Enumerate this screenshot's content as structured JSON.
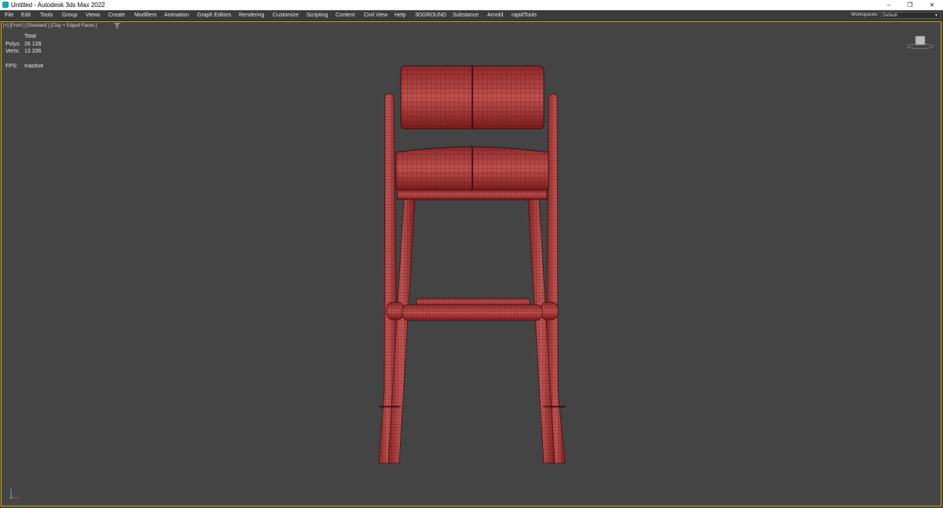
{
  "window": {
    "title": "Untitled - Autodesk 3ds Max 2022",
    "controls": {
      "minimize": "–",
      "restore": "❐",
      "close": "✕"
    }
  },
  "menu": {
    "items": [
      "File",
      "Edit",
      "Tools",
      "Group",
      "Views",
      "Create",
      "Modifiers",
      "Animation",
      "Graph Editors",
      "Rendering",
      "Customize",
      "Scripting",
      "Content",
      "Civil View",
      "Help",
      "3DGROUND",
      "Substance",
      "Arnold",
      "rapidTools"
    ],
    "workspaces_label": "Workspaces:",
    "workspaces_value": "Default"
  },
  "viewport": {
    "label": "[+] [Front ] [Standard ] [Clay + Edged Faces ]",
    "filter_icon": "funnel-icon",
    "stats": {
      "total_label": "Total",
      "polys_label": "Polys:",
      "polys_value": "26 128",
      "verts_label": "Verts:",
      "verts_value": "13 336",
      "fps_label": "FPS:",
      "fps_value": "Inactive"
    },
    "border_color": "#c8a200",
    "background_color": "#444444",
    "model_color": "#b04444",
    "wire_color": "#5a1010"
  }
}
